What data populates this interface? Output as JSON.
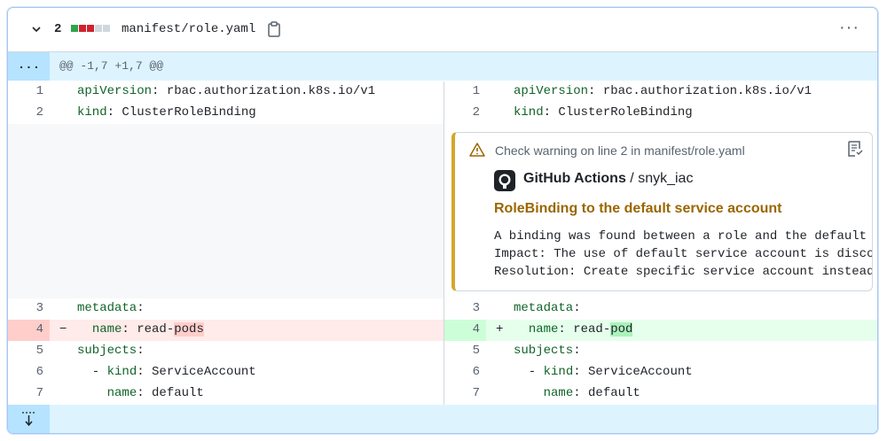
{
  "file": {
    "changes_count": "2",
    "name": "manifest/role.yaml",
    "diffstat_colors": [
      "#2da44e",
      "#cf222e",
      "#cf222e",
      "#d0d7de",
      "#d0d7de"
    ]
  },
  "hunk": {
    "expand_label": "...",
    "header": "@@ -1,7 +1,7 @@"
  },
  "left": [
    {
      "num": "1",
      "key": "apiVersion",
      "val": " rbac.authorization.k8s.io/v1"
    },
    {
      "num": "2",
      "key": "kind",
      "val": " ClusterRoleBinding"
    },
    {
      "num": "3",
      "key": "metadata",
      "val": ""
    },
    {
      "num": "4",
      "sign": "−",
      "indent": "  ",
      "key": "name",
      "val_pre": " read-",
      "val_hl": "pods"
    },
    {
      "num": "5",
      "key": "subjects",
      "val": ""
    },
    {
      "num": "6",
      "indent": "  - ",
      "key": "kind",
      "val": " ServiceAccount"
    },
    {
      "num": "7",
      "indent": "    ",
      "key": "name",
      "val": " default"
    }
  ],
  "right": [
    {
      "num": "1",
      "key": "apiVersion",
      "val": " rbac.authorization.k8s.io/v1"
    },
    {
      "num": "2",
      "key": "kind",
      "val": " ClusterRoleBinding"
    },
    {
      "num": "3",
      "key": "metadata",
      "val": ""
    },
    {
      "num": "4",
      "sign": "+",
      "indent": "  ",
      "key": "name",
      "val_pre": " read-",
      "val_hl": "pod"
    },
    {
      "num": "5",
      "key": "subjects",
      "val": ""
    },
    {
      "num": "6",
      "indent": "  - ",
      "key": "kind",
      "val": " ServiceAccount"
    },
    {
      "num": "7",
      "indent": "    ",
      "key": "name",
      "val": " default"
    }
  ],
  "annotation": {
    "title": "Check warning on line 2 in manifest/role.yaml",
    "source_app": "GitHub Actions",
    "source_sep": " / ",
    "source_job": "snyk_iac",
    "heading": "RoleBinding to the default service account",
    "body_lines": [
      "A binding was found between a role and the default s",
      "Impact: The use of default service account is discou",
      "Resolution: Create specific service account instead"
    ]
  },
  "colors": {
    "warning_accent": "#d4a72c",
    "heading": "#9a6700",
    "deletion": "#ffebe9",
    "addition": "#e6ffec"
  }
}
